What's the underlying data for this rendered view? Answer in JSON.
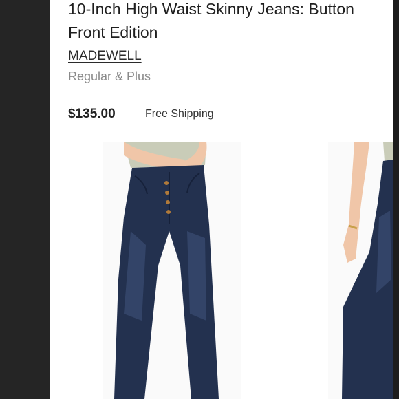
{
  "product": {
    "title": "10-Inch High Waist Skinny Jeans: Button Front Edition",
    "brand": "MADEWELL",
    "size_range": "Regular & Plus",
    "price": "$135.00",
    "shipping": "Free Shipping"
  },
  "gallery": {
    "images": [
      {
        "icon": "jeans-front-photo"
      },
      {
        "icon": "jeans-side-photo"
      }
    ]
  },
  "colors": {
    "denim": "#23314f",
    "denim_light": "#3a4d73",
    "skin": "#f0c6a8",
    "top": "#c9ccb8",
    "button": "#b07a3a"
  }
}
